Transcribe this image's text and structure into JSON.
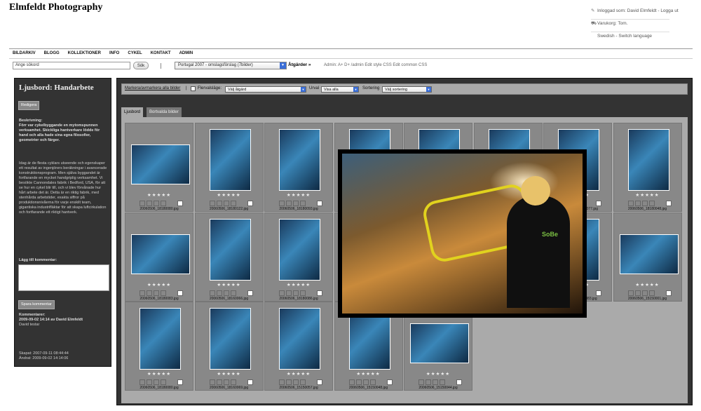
{
  "site": {
    "title": "Elmfeldt Photography"
  },
  "user_box": {
    "logged_in": "Inloggad som: David Elmfeldt - Logga ut",
    "cart": "Varukorg: Tom.",
    "language": "Swedish - Switch language"
  },
  "nav": [
    "BILDARKIV",
    "BLOGG",
    "KOLLEKTIONER",
    "INFO",
    "CYKEL",
    "KONTAKT",
    "ADMIN"
  ],
  "search": {
    "placeholder": "Ange sökord",
    "button": "Sök"
  },
  "album": {
    "selected": "Portugal 2007 - omslagsförslag (7bilder)",
    "actions": "Åtgärder »"
  },
  "admin_links": "Admin: A+ D+ /admin Edit style CSS Edit common CSS",
  "sidebar": {
    "title": "Ljusbord: Handarbete",
    "edit_button": "Redigera",
    "description_heading": "Beskrivning:",
    "description_bold": "Förr var cykelbyggande en mytomspunnen verksamhet. Skickliga hantverkare lödde för hand och alla hade sina egna filosofier, geometrier och färger.",
    "description_text": "Idag är de flesta cyklars utseende och egenskaper ett resultat av ingenjörers beräkningar i avancerade konstruktionsprogram. Men själva byggandet är fortfarande en mycket handgriplig verksamhet. Vi besökte Cannondales fabrik i Bedford, USA, för att se hur en cykel blir till, och vi blev förvånade hur hårt arbete det är. Detta är en riktig fabrik, med stenhårda arbetstider, exakta siffror på produktionsnivåerna för varje enskilt team, gigantiska industrifläktar för att skapa luftcirkulation och fortfarande ett riktigt hantverk.",
    "comment_label": "Lägg till kommentar:",
    "save_comment": "Spara kommentar",
    "comments_heading": "Kommentarer:",
    "comment_meta": "2009-09-02 14:14 av David Elmfeldt",
    "comment_text": "David testar",
    "created": "Skapat: 2007-09-11 08:44:44",
    "modified": "Ändrat: 2009-09-02 14:14:06"
  },
  "toolbar": {
    "select_all": "Markera/avmarkera alla bilder",
    "multi_label": "Flervalsläge:",
    "multi_value": "Välj åtgärd",
    "filter_label": "Urval",
    "filter_value": "Visa alla",
    "sort_label": "Sortering",
    "sort_value": "Välj sortering"
  },
  "tabs": [
    "Ljusbord",
    "Bortvalda bilder"
  ],
  "stars": "★★★★★",
  "thumbnails": [
    {
      "file": "20060506_18180080.jpg",
      "orient": "landscape"
    },
    {
      "file": "20060506_18180122.jpg",
      "orient": "portrait"
    },
    {
      "file": "20060506_18180093.jpg",
      "orient": "portrait"
    },
    {
      "file": "",
      "orient": "portrait"
    },
    {
      "file": "",
      "orient": "portrait"
    },
    {
      "file": "",
      "orient": "portrait"
    },
    {
      "file": "20060506_181800077.jpg",
      "orient": "portrait"
    },
    {
      "file": "20060506_18180048.jpg",
      "orient": "portrait"
    },
    {
      "file": "20060506_18180083.jpg",
      "orient": "landscape"
    },
    {
      "file": "20060506_18160066.jpg",
      "orient": "portrait"
    },
    {
      "file": "20060506_18180086.jpg",
      "orient": "portrait"
    },
    {
      "file": "",
      "orient": "portrait"
    },
    {
      "file": "",
      "orient": "portrait"
    },
    {
      "file": "",
      "orient": "portrait"
    },
    {
      "file": "20060506_15150083.jpg",
      "orient": "portrait"
    },
    {
      "file": "20060506_15150001.jpg",
      "orient": "landscape"
    },
    {
      "file": "20060506_18180080.jpg",
      "orient": "portrait"
    },
    {
      "file": "20060506_18160069.jpg",
      "orient": "portrait"
    },
    {
      "file": "20060506_15150057.jpg",
      "orient": "portrait"
    },
    {
      "file": "20060506_15150048.jpg",
      "orient": "portrait"
    },
    {
      "file": "20060506_15150044.jpg",
      "orient": "landscape"
    }
  ],
  "colors": {
    "panel": "#333333",
    "grid": "#aaaaaa",
    "cell": "#888888",
    "accent": "#3b6fd8"
  }
}
